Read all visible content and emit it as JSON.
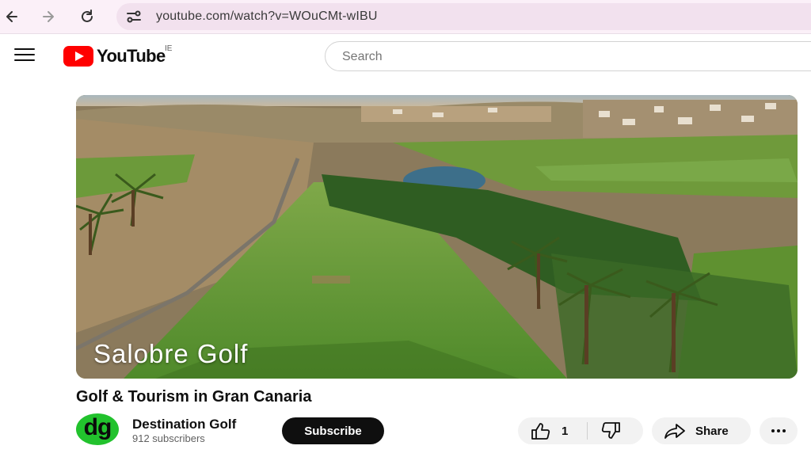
{
  "browser": {
    "url": "youtube.com/watch?v=WOuCMt-wIBU",
    "icons": [
      "back-arrow-icon",
      "forward-arrow-icon",
      "reload-icon",
      "site-info-icon"
    ]
  },
  "header": {
    "logo_text": "YouTube",
    "region": "IE",
    "search_placeholder": "Search"
  },
  "video": {
    "overlay_caption": "Salobre Golf",
    "title": "Golf & Tourism in Gran Canaria"
  },
  "channel": {
    "name": "Destination Golf",
    "subscribers": "912 subscribers",
    "avatar_text": "dg",
    "subscribe_label": "Subscribe"
  },
  "actions": {
    "like_count": "1",
    "share_label": "Share"
  },
  "colors": {
    "brand_red": "#ff0000",
    "avatar_green": "#22c22d",
    "subscribe_bg": "#0f0f0f"
  }
}
